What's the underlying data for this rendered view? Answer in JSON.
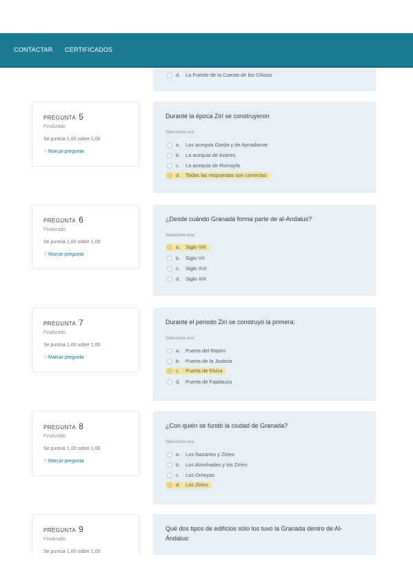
{
  "nav": {
    "contact": "CONTACTAR",
    "certificates": "CERTIFICADOS"
  },
  "partial_top": {
    "option": {
      "letter": "d.",
      "text": "La Fuente de la Cuesta de los Chinos"
    }
  },
  "common": {
    "question_label": "PREGUNTA",
    "state": "Finalizado",
    "grade": "Se puntúa 1,00 sobre 1,00",
    "flag": "Marcar pregunta",
    "select_prompt": "Seleccione una:"
  },
  "questions": [
    {
      "number": "5",
      "text": "Durante la época Zirí se construyeron",
      "options": [
        {
          "letter": "a.",
          "text": "Los acequia Gorda y de Aynadamar"
        },
        {
          "letter": "b.",
          "text": "La acequia de Axares"
        },
        {
          "letter": "c.",
          "text": "La acequia de Romayla"
        },
        {
          "letter": "d.",
          "text": "Todas las respuestas son correctas"
        }
      ],
      "selected": "d"
    },
    {
      "number": "6",
      "text": "¿Desde cuándo Granada forma parte de al-Andalus?",
      "options": [
        {
          "letter": "a.",
          "text": "Siglo VIII"
        },
        {
          "letter": "b.",
          "text": "Siglo VII"
        },
        {
          "letter": "c.",
          "text": "Siglo XVI"
        },
        {
          "letter": "d.",
          "text": "Siglo XIII"
        }
      ],
      "selected": "a"
    },
    {
      "number": "7",
      "text": "Durante el periodo Zirí se construyó la primera:",
      "options": [
        {
          "letter": "a.",
          "text": "Puerta del Rastro"
        },
        {
          "letter": "b.",
          "text": "Puerta de la Justicia"
        },
        {
          "letter": "c.",
          "text": "Puerta de Elvira"
        },
        {
          "letter": "d.",
          "text": "Puerta de Fajalauza"
        }
      ],
      "selected": "c"
    },
    {
      "number": "8",
      "text": "¿Con quién se fundó la ciudad de Granada?",
      "options": [
        {
          "letter": "a.",
          "text": "Los Nazaríes y Ziríes"
        },
        {
          "letter": "b.",
          "text": "Los Almohades y los Ziríes"
        },
        {
          "letter": "c.",
          "text": "Los Omeyas"
        },
        {
          "letter": "d.",
          "text": "Los Ziríes"
        }
      ],
      "selected": "d"
    },
    {
      "number": "9",
      "text": "Qué dos tipos de edificios sólo los tuvo la Granada dentro de Al-Ándalus:"
    }
  ]
}
